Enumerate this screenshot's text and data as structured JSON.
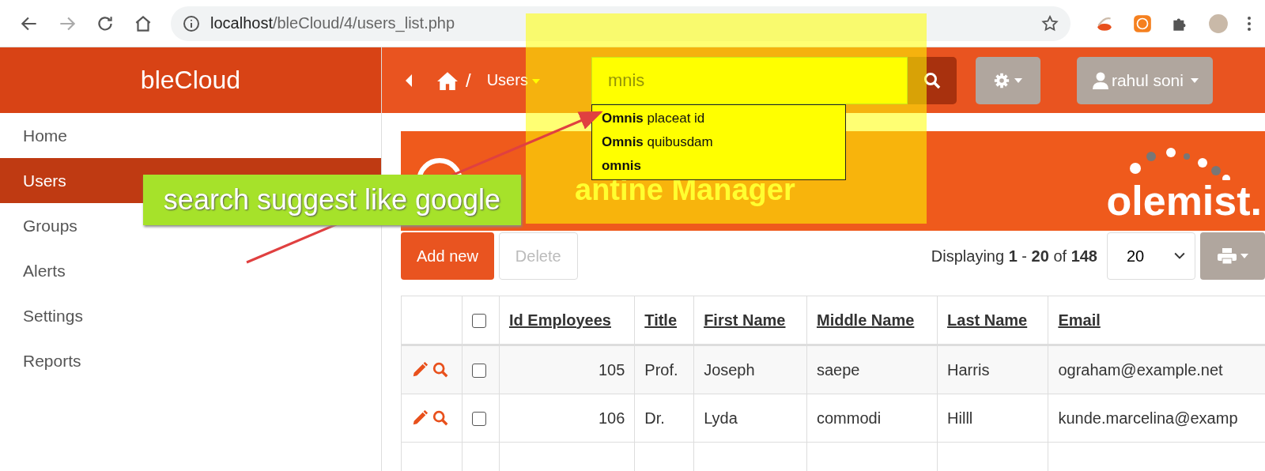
{
  "browser": {
    "url_host": "localhost",
    "url_path": "/bleCloud/4/users_list.php"
  },
  "sidebar": {
    "brand": "bleCloud",
    "items": [
      {
        "label": "Home",
        "selected": false
      },
      {
        "label": "Users",
        "selected": true
      },
      {
        "label": "Groups",
        "selected": false
      },
      {
        "label": "Alerts",
        "selected": false
      },
      {
        "label": "Settings",
        "selected": false
      },
      {
        "label": "Reports",
        "selected": false
      }
    ]
  },
  "header": {
    "breadcrumb": "/",
    "section": "Users",
    "search": {
      "value": "mnis"
    },
    "user": "rahul soni"
  },
  "suggestions": [
    "**Omnis** placeat id",
    "**Omnis** quibusdam",
    "**omnis**"
  ],
  "banner": {
    "title": "antine Manager",
    "logo": "olemist."
  },
  "toolbar": {
    "add": "Add new",
    "delete": "Delete",
    "paging": "Displaying **1** - **20** of **148**",
    "page_size": "20"
  },
  "table": {
    "columns": [
      "Id Employees",
      "Title",
      "First Name",
      "Middle Name",
      "Last Name",
      "Email"
    ],
    "header_checked": false,
    "rows": [
      {
        "checked": false,
        "cells": [
          "105",
          "Prof.",
          "Joseph",
          "saepe",
          "Harris",
          "ograham@example.net"
        ]
      },
      {
        "checked": false,
        "cells": [
          "106",
          "Dr.",
          "Lyda",
          "commodi",
          "Hilll",
          "kunde.marcelina@examp"
        ]
      }
    ]
  },
  "callout": "search suggest like google"
}
